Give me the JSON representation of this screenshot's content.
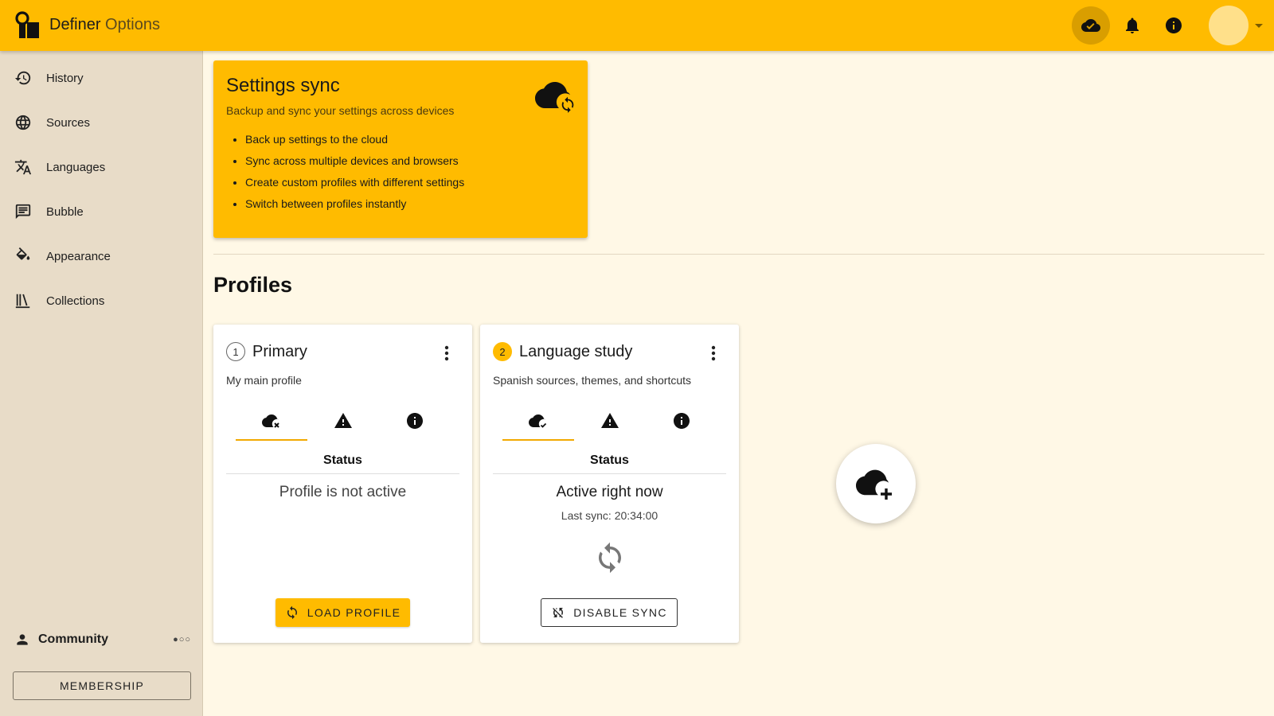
{
  "app": {
    "name": "Definer",
    "subtitle": "Options"
  },
  "topbar": {
    "icons": [
      "cloud-done-icon",
      "bell-icon",
      "info-icon",
      "avatar"
    ]
  },
  "sidebar": {
    "items": [
      {
        "label": "History",
        "icon": "history-icon"
      },
      {
        "label": "Sources",
        "icon": "globe-icon"
      },
      {
        "label": "Languages",
        "icon": "translate-icon"
      },
      {
        "label": "Bubble",
        "icon": "chat-bubble-icon"
      },
      {
        "label": "Appearance",
        "icon": "paint-bucket-icon"
      },
      {
        "label": "Collections",
        "icon": "library-icon"
      }
    ],
    "community": {
      "label": "Community",
      "dots": "●○○"
    },
    "membership_label": "MEMBERSHIP"
  },
  "settings_sync": {
    "title": "Settings sync",
    "description": "Backup and sync your settings across devices",
    "features": [
      "Back up settings to the cloud",
      "Sync across multiple devices and browsers",
      "Create custom profiles with different settings",
      "Switch between profiles instantly"
    ]
  },
  "profiles": {
    "title": "Profiles",
    "cards": [
      {
        "number": "1",
        "name": "Primary",
        "description": "My main profile",
        "status_heading": "Status",
        "status": "Profile is not active",
        "button_label": "LOAD PROFILE"
      },
      {
        "number": "2",
        "name": "Language study",
        "description": "Spanish sources, themes, and shortcuts",
        "status_heading": "Status",
        "status": "Active right now",
        "last_sync": "Last sync: 20:34:00",
        "button_label": "DISABLE SYNC"
      }
    ]
  },
  "colors": {
    "accent": "#ffbb00",
    "background": "#fff8e6",
    "sidebar": "#e8dcc8"
  }
}
